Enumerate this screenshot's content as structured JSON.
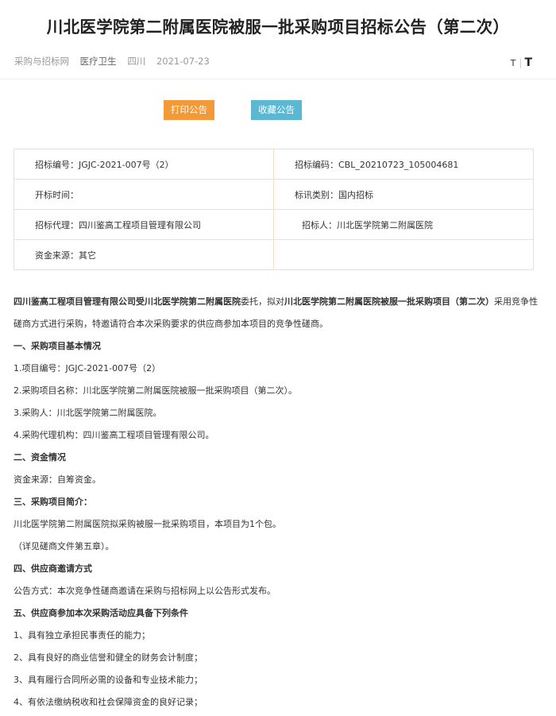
{
  "header": {
    "title": "川北医学院第二附属医院被服一批采购项目招标公告（第二次）",
    "site": "采购与招标网",
    "category": "医疗卫生",
    "region": "四川",
    "date": "2021-07-23",
    "font_small": "T",
    "font_large": "T"
  },
  "actions": {
    "print": "打印公告",
    "favorite": "收藏公告"
  },
  "info": {
    "bid_no": "招标编号：JGJC-2021-007号（2）",
    "bid_code": "招标编码：CBL_20210723_105004681",
    "open_time": "开标时间：",
    "bid_type": "标讯类别：国内招标",
    "agent": "招标代理：四川鉴高工程项目管理有限公司",
    "tenderer": "招标人：川北医学院第二附属医院",
    "fund_source": "资金来源：其它"
  },
  "content": {
    "intro_bold1": "四川鉴高工程项目管理有限公司受川北医学院第二附属医院",
    "intro_mid": "委托，拟对",
    "intro_bold2": "川北医学院第二附属医院被服一批采购项目（第二次）",
    "intro_rest": "采用竞争性磋商方式进行采购，特邀请符合本次采购要求的供应商参加本项目的竞争性磋商。",
    "s1": "一、采购项目基本情况",
    "s1_1": "1.项目编号：JGJC-2021-007号（2）",
    "s1_2": "2.采购项目名称：川北医学院第二附属医院被服一批采购项目（第二次）。",
    "s1_3": "3.采购人：川北医学院第二附属医院。",
    "s1_4": "4.采购代理机构：四川鉴高工程项目管理有限公司。",
    "s2": "二、资金情况",
    "s2_1": "资金来源：自筹资金。",
    "s3": "三、采购项目简介：",
    "s3_1": "川北医学院第二附属医院拟采购被服一批采购项目，本项目为1个包。",
    "s3_2": "（详见磋商文件第五章）。",
    "s4": "四、供应商邀请方式",
    "s4_1": "公告方式：本次竞争性磋商邀请在采购与招标网上以公告形式发布。",
    "s5": "五、供应商参加本次采购活动应具备下列条件",
    "s5_1": "1、具有独立承担民事责任的能力；",
    "s5_2": "2、具有良好的商业信誉和健全的财务会计制度；",
    "s5_3": "3、具有履行合同所必需的设备和专业技术能力；",
    "s5_4": "4、有依法缴纳税收和社会保障资金的良好记录；"
  }
}
